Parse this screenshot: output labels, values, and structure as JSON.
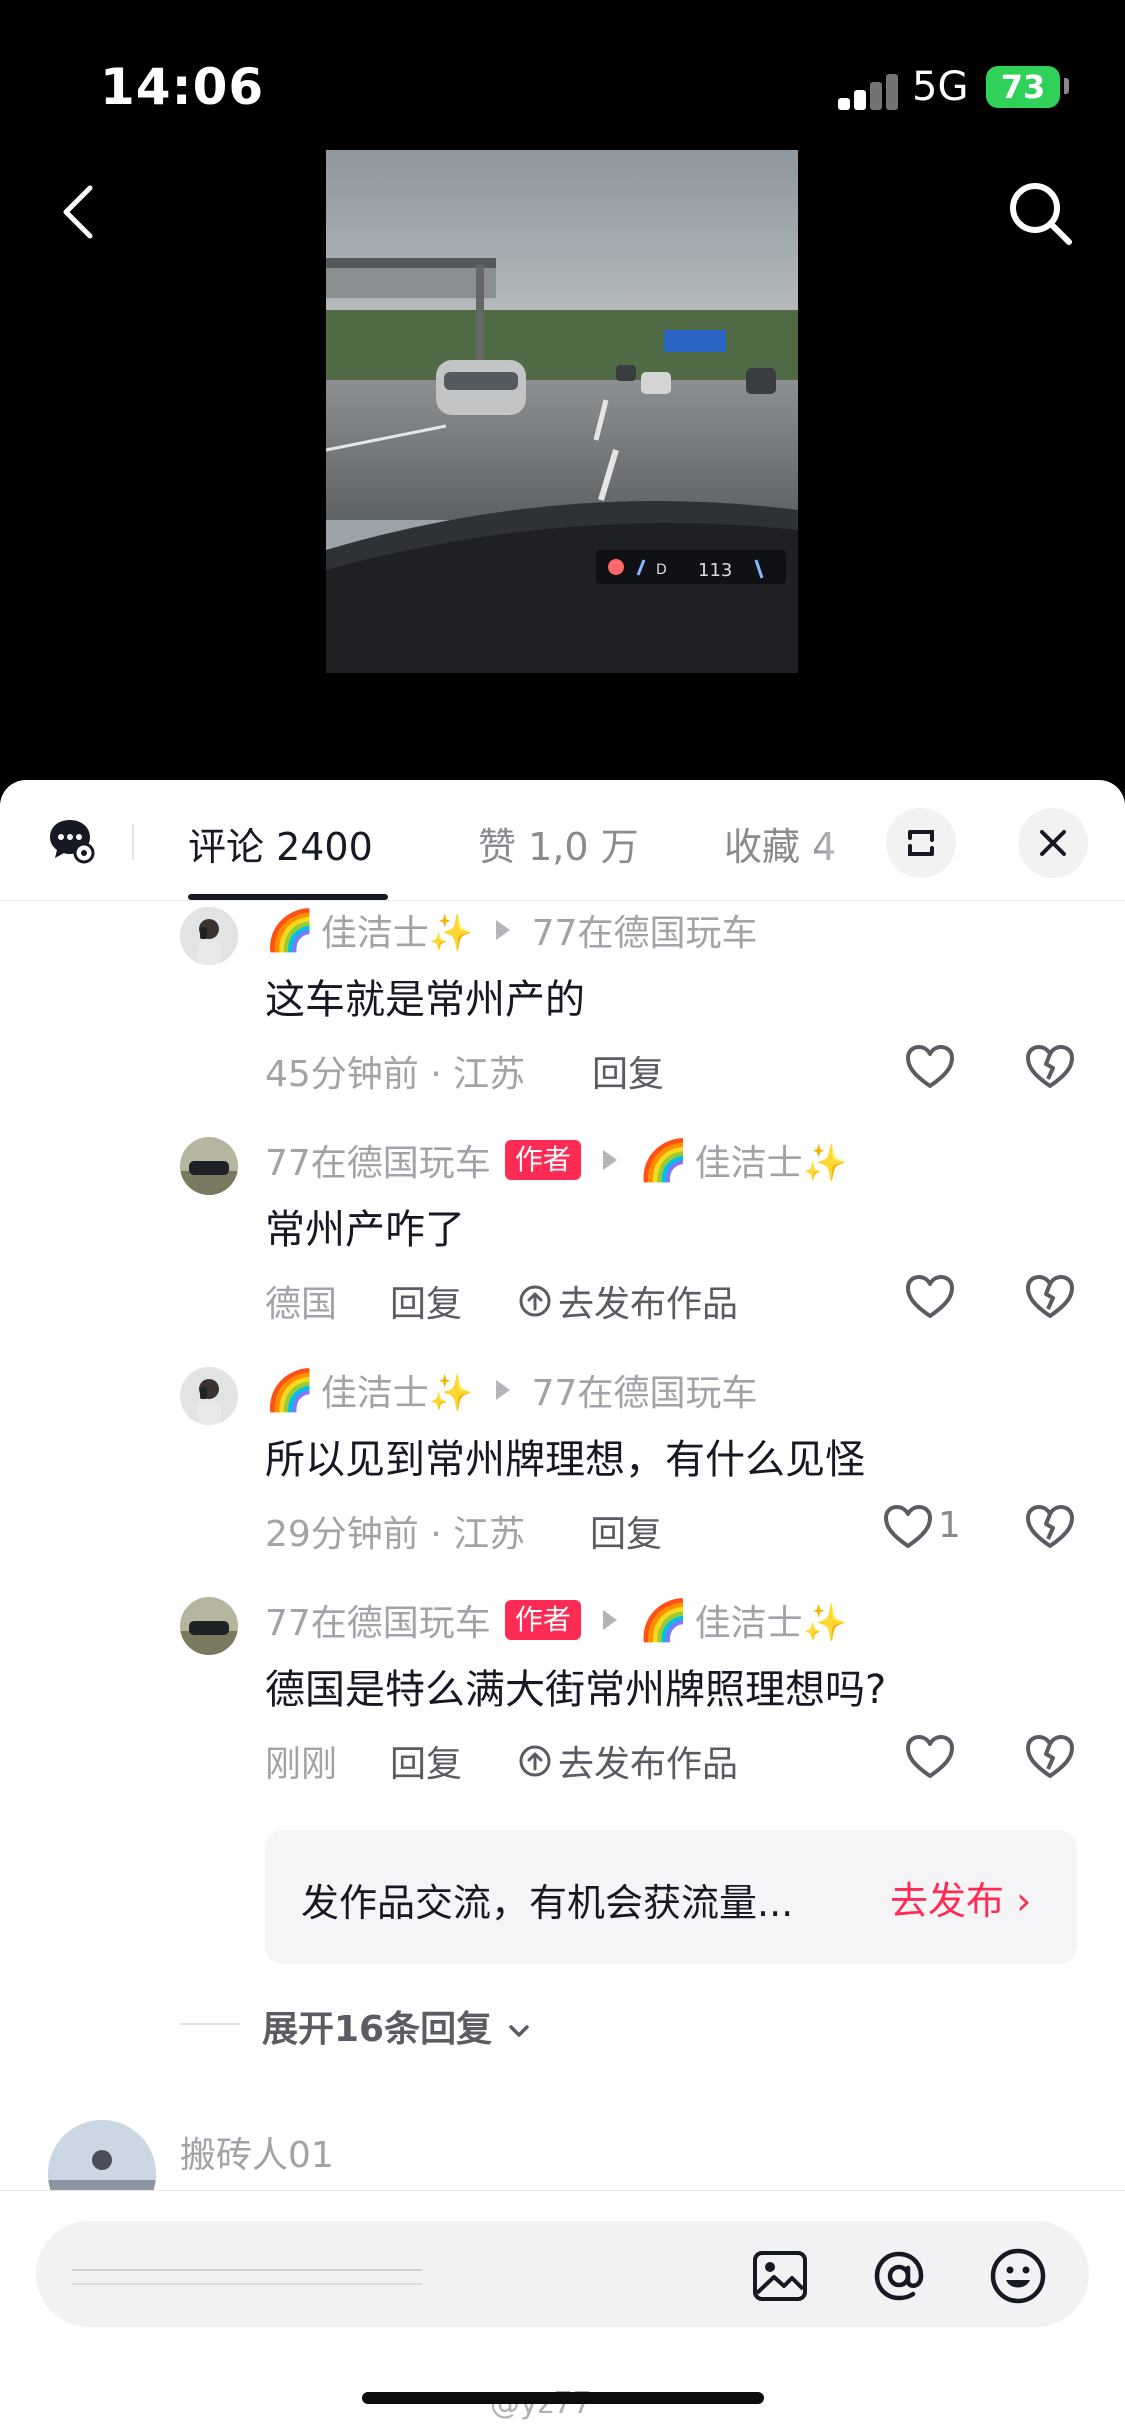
{
  "status_bar": {
    "time": "14:06",
    "network": "5G",
    "battery": "73"
  },
  "tabs": [
    {
      "label": "评论 2400",
      "active": true
    },
    {
      "label": "赞 1,0 万",
      "active": false
    },
    {
      "label": "收藏 4",
      "active": false
    }
  ],
  "comments": [
    {
      "author": "佳洁士✨",
      "reply_to": "77在德国玩车",
      "author_badge": "",
      "text": "这车就是常州产的",
      "meta": "45分钟前 · 江苏",
      "reply_label": "回复",
      "publish_label": "",
      "like_count": ""
    },
    {
      "author": "77在德国玩车",
      "reply_to": "佳洁士✨",
      "author_badge": "作者",
      "text": "常州产咋了",
      "meta": "德国",
      "reply_label": "回复",
      "publish_label": "去发布作品",
      "like_count": ""
    },
    {
      "author": "佳洁士✨",
      "reply_to": "77在德国玩车",
      "author_badge": "",
      "text": "所以见到常州牌理想，有什么见怪",
      "meta": "29分钟前 · 江苏",
      "reply_label": "回复",
      "publish_label": "",
      "like_count": "1"
    },
    {
      "author": "77在德国玩车",
      "reply_to": "佳洁士✨",
      "author_badge": "作者",
      "text": "德国是特么满大街常州牌照理想吗?",
      "meta": "刚刚",
      "reply_label": "回复",
      "publish_label": "去发布作品",
      "like_count": ""
    }
  ],
  "promo": {
    "text": "发作品交流，有机会获流量...",
    "button": "去发布 ›"
  },
  "expand_replies": "展开16条回复",
  "next_comment": {
    "author": "搬砖人01"
  },
  "watermark": "@yz77",
  "colors": {
    "accent": "#fe2c55",
    "battery": "#2fd158"
  }
}
